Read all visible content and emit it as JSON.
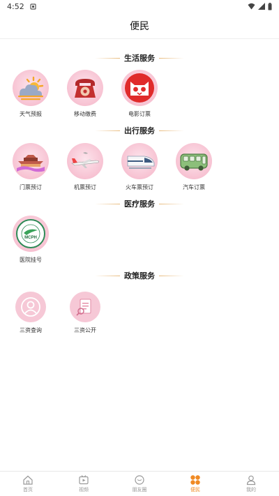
{
  "status_bar": {
    "time": "4:52"
  },
  "header": {
    "title": "便民"
  },
  "sections": [
    {
      "title": "生活服务",
      "items": [
        {
          "label": "天气预报",
          "icon": "weather-icon"
        },
        {
          "label": "移动缴费",
          "icon": "telephone-icon"
        },
        {
          "label": "电影订票",
          "icon": "cat-icon"
        }
      ]
    },
    {
      "title": "出行服务",
      "items": [
        {
          "label": "门票预订",
          "icon": "temple-icon"
        },
        {
          "label": "机票预订",
          "icon": "airplane-icon"
        },
        {
          "label": "火车票预订",
          "icon": "train-icon"
        },
        {
          "label": "汽车订票",
          "icon": "bus-icon"
        }
      ]
    },
    {
      "title": "医疗服务",
      "items": [
        {
          "label": "医院挂号",
          "icon": "hospital-logo-icon",
          "logo_text": "MCPH"
        }
      ]
    },
    {
      "title": "政策服务",
      "items": [
        {
          "label": "三资查询",
          "icon": "user-icon"
        },
        {
          "label": "三资公开",
          "icon": "document-icon"
        }
      ]
    }
  ],
  "bottom_nav": [
    {
      "label": "首页",
      "icon": "home-icon",
      "active": false
    },
    {
      "label": "视频",
      "icon": "video-icon",
      "active": false
    },
    {
      "label": "朋友圈",
      "icon": "chat-icon",
      "active": false
    },
    {
      "label": "便民",
      "icon": "grid-icon",
      "active": true
    },
    {
      "label": "我的",
      "icon": "profile-icon",
      "active": false
    }
  ],
  "colors": {
    "accent": "#f08a24",
    "pink": "#f6c8d6",
    "gold_line": "#e7b878"
  }
}
